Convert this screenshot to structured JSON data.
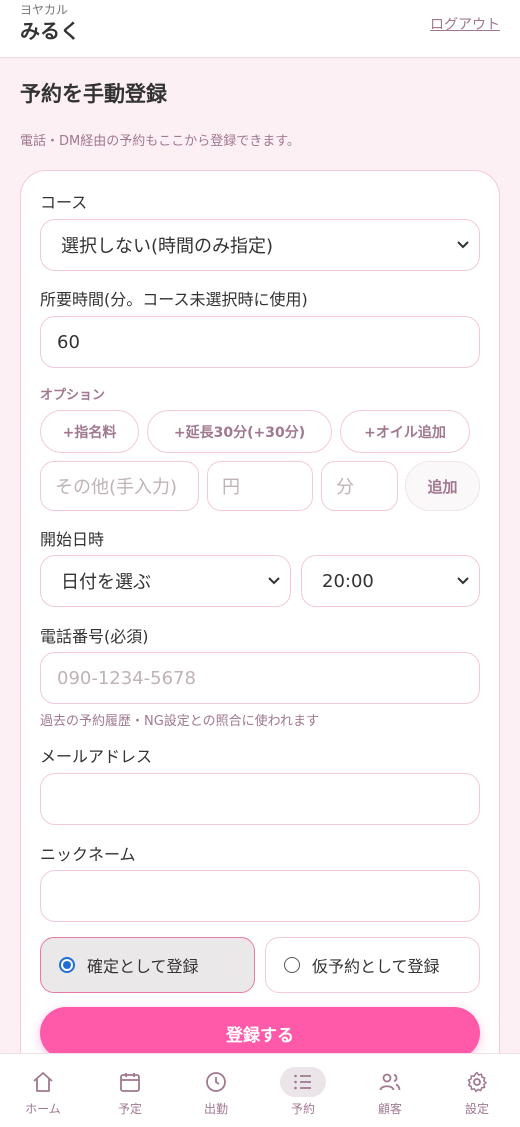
{
  "header": {
    "brand_sub": "ヨヤカル",
    "brand_name": "みるく",
    "logout": "ログアウト"
  },
  "page": {
    "title": "予約を手動登録",
    "subtitle": "電話・DM経由の予約もここから登録できます。"
  },
  "form": {
    "course": {
      "label": "コース",
      "value": "選択しない(時間のみ指定)"
    },
    "duration": {
      "label": "所要時間(分。コース未選択時に使用)",
      "value": "60"
    },
    "options": {
      "label": "オプション",
      "chips": [
        "+指名料",
        "+延長30分(+30分)",
        "+オイル追加"
      ],
      "custom_name_placeholder": "その他(手入力)",
      "custom_price_placeholder": "円",
      "custom_minutes_placeholder": "分",
      "add_label": "追加"
    },
    "start": {
      "label": "開始日時",
      "date_value": "日付を選ぶ",
      "time_value": "20:00"
    },
    "phone": {
      "label": "電話番号(必須)",
      "placeholder": "090-1234-5678",
      "hint": "過去の予約履歴・NG設定との照合に使われます"
    },
    "email": {
      "label": "メールアドレス",
      "value": ""
    },
    "nickname": {
      "label": "ニックネーム",
      "value": ""
    },
    "status": {
      "confirmed_label": "確定として登録",
      "tentative_label": "仮予約として登録",
      "selected": "confirmed"
    },
    "submit_label": "登録する"
  },
  "nav": {
    "items": [
      {
        "label": "ホーム",
        "icon": "home-icon"
      },
      {
        "label": "予定",
        "icon": "calendar-icon"
      },
      {
        "label": "出勤",
        "icon": "clock-icon"
      },
      {
        "label": "予約",
        "icon": "list-icon"
      },
      {
        "label": "顧客",
        "icon": "users-icon"
      },
      {
        "label": "設定",
        "icon": "gear-icon"
      }
    ],
    "active": "予約"
  },
  "colors": {
    "accent": "#ff5aaa",
    "muted": "#a07890",
    "border": "#f4c9da",
    "background": "#fdf0f5"
  }
}
